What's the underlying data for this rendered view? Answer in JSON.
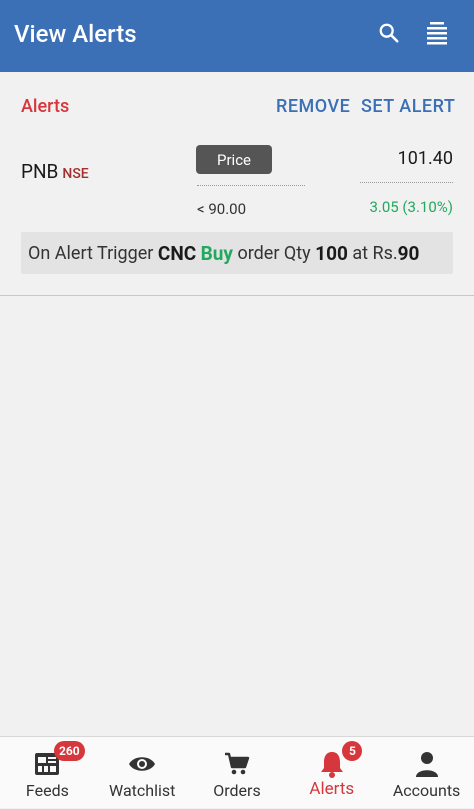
{
  "appbar": {
    "title": "View Alerts",
    "search_icon": "search-icon",
    "menu_icon": "list-menu-icon",
    "color": "#3b6fb6"
  },
  "toolbar": {
    "section_label": "Alerts",
    "remove_label": "REMOVE",
    "set_alert_label": "SET ALERT"
  },
  "alert": {
    "symbol": "PNB",
    "exchange": "NSE",
    "type_chip": "Price",
    "last_price": "101.40",
    "condition": "< 90.00",
    "change": "3.05 (3.10%)",
    "trigger": {
      "prefix": "On Alert Trigger",
      "product": "CNC",
      "side": "Buy",
      "qty_label": "order Qty",
      "qty": "100",
      "price_label": "at Rs.",
      "price": "90"
    }
  },
  "bottom_nav": {
    "items": [
      {
        "label": "Feeds",
        "icon": "feeds-icon",
        "badge": "260"
      },
      {
        "label": "Watchlist",
        "icon": "eye-icon"
      },
      {
        "label": "Orders",
        "icon": "cart-icon"
      },
      {
        "label": "Alerts",
        "icon": "bell-icon",
        "badge": "5",
        "active": true
      },
      {
        "label": "Accounts",
        "icon": "person-icon"
      }
    ]
  },
  "colors": {
    "accent_red": "#d5373d",
    "accent_blue": "#3b6fb6",
    "positive_green": "#22a85f"
  }
}
